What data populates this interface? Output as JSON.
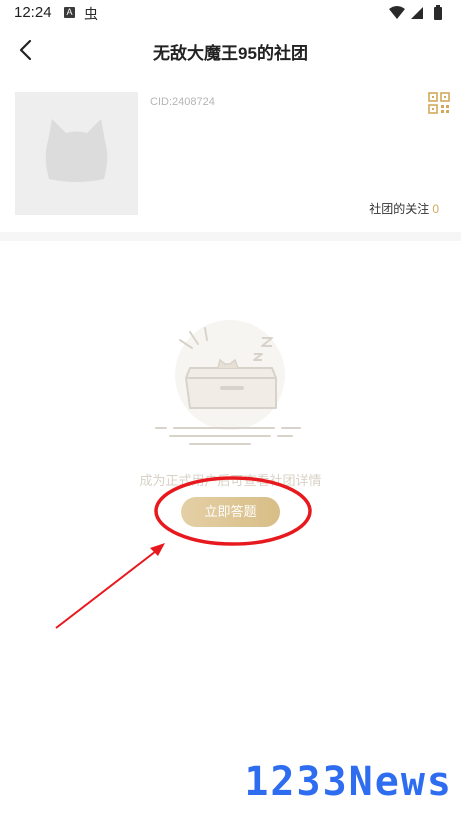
{
  "status_bar": {
    "time": "12:24",
    "notif_a": "A",
    "notif_bug": "虫"
  },
  "header": {
    "title": "无敌大魔王95的社团"
  },
  "club": {
    "cid": "CID:2408724",
    "follow_label": "社团的关注",
    "follow_count": "0"
  },
  "empty_state": {
    "message": "成为正式用户后可查看社团详情",
    "button_label": "立即答题"
  },
  "watermark": "1233News",
  "colors": {
    "accent_gold": "#d2a95c",
    "button_gold": "#dcc48f",
    "annotation_red": "#e8191e",
    "watermark_blue": "#2f6df0"
  }
}
